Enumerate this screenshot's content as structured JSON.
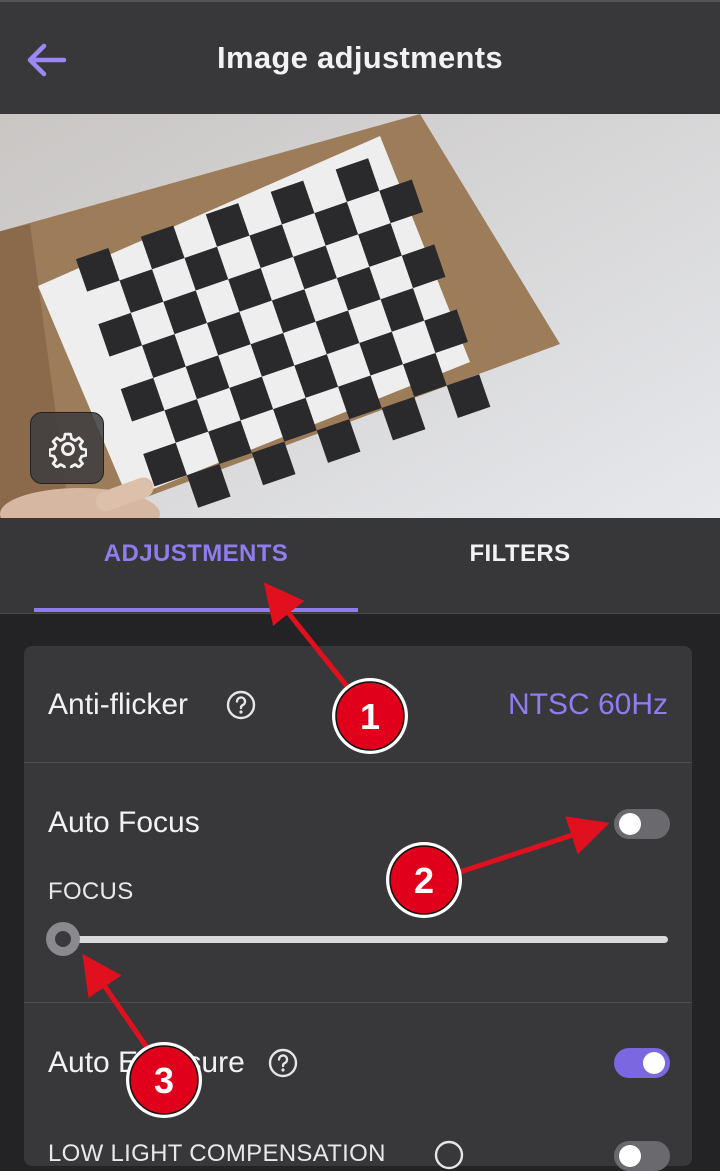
{
  "header": {
    "title": "Image adjustments",
    "back_icon": "arrow-left-icon"
  },
  "preview": {
    "settings_icon": "gear-icon"
  },
  "tabs": [
    {
      "label": "ADJUSTMENTS",
      "active": true
    },
    {
      "label": "FILTERS",
      "active": false
    }
  ],
  "anti_flicker": {
    "label": "Anti-flicker",
    "value": "NTSC 60Hz"
  },
  "auto_focus": {
    "label": "Auto Focus",
    "enabled": false
  },
  "focus": {
    "label": "FOCUS",
    "value": 0
  },
  "auto_exposure": {
    "label": "Auto Exposure",
    "enabled": true
  },
  "low_light": {
    "label": "LOW LIGHT COMPENSATION",
    "enabled": false
  },
  "annotations": [
    "1",
    "2",
    "3"
  ],
  "colors": {
    "accent": "#8f7cf0",
    "badge": "#e0001b",
    "arrow": "#e0101e"
  }
}
